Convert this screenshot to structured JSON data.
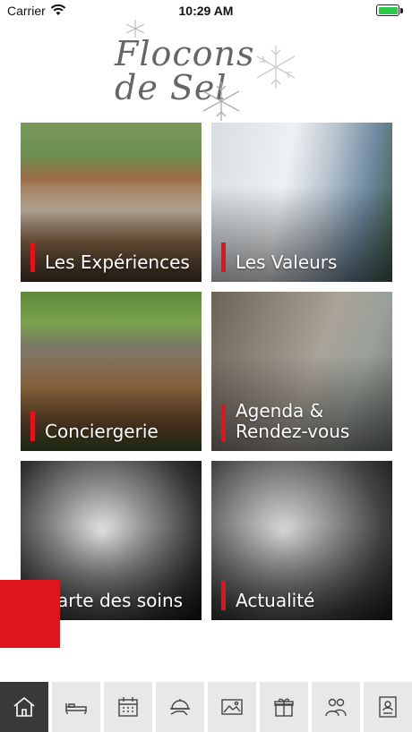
{
  "status_bar": {
    "carrier": "Carrier",
    "time": "10:29 AM",
    "battery_level": 1.0
  },
  "logo": {
    "line1": "Flocons",
    "line2": "de Sel"
  },
  "tiles": [
    {
      "label": "Les Expériences"
    },
    {
      "label": "Les Valeurs"
    },
    {
      "label": "Conciergerie"
    },
    {
      "label": "Agenda &\nRendez-vous"
    },
    {
      "label": "Carte des soins"
    },
    {
      "label": "Actualité"
    }
  ],
  "tabbar": {
    "active_index": 0,
    "tabs": [
      {
        "icon": "home-icon"
      },
      {
        "icon": "bed-icon"
      },
      {
        "icon": "calendar-icon"
      },
      {
        "icon": "room-service-icon"
      },
      {
        "icon": "image-icon"
      },
      {
        "icon": "gift-icon"
      },
      {
        "icon": "people-icon"
      },
      {
        "icon": "contact-card-icon"
      }
    ]
  },
  "colors": {
    "accent": "#e0141e",
    "active_tab": "#3a3a3a",
    "tab_bg": "#e8e8e8"
  }
}
